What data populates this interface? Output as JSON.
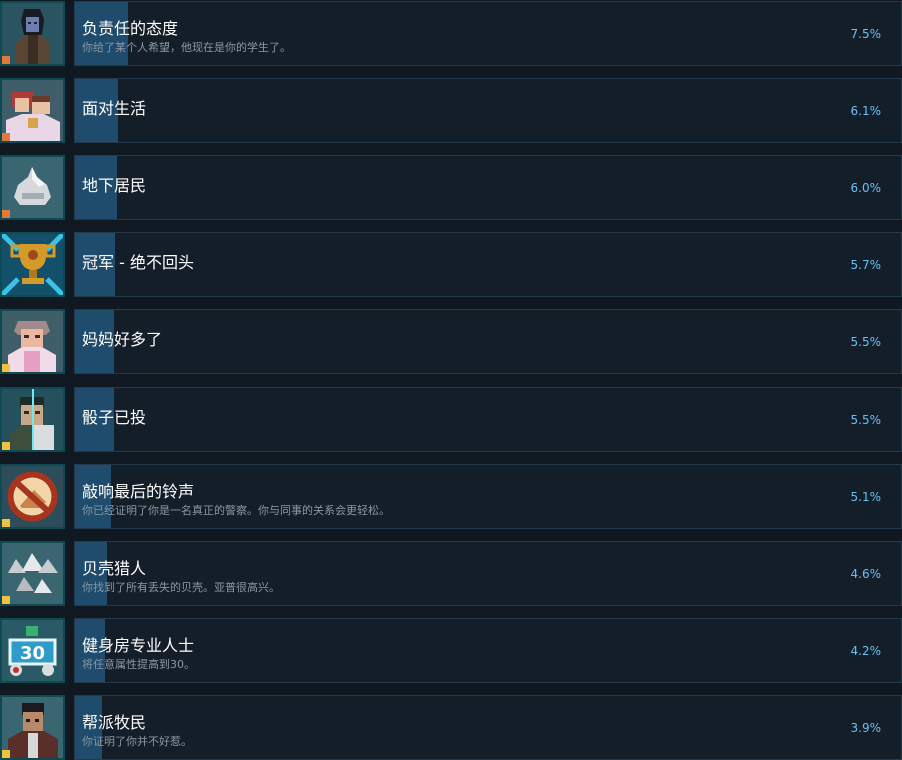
{
  "achievements": [
    {
      "icon": "dark-haired-character-icon",
      "title": "负责任的态度",
      "description": "你给了某个人希望，他现在是你的学生了。",
      "percent_label": "7.5%",
      "percent": 7.5
    },
    {
      "icon": "couple-wedding-icon",
      "title": "面对生活",
      "description": "",
      "percent_label": "6.1%",
      "percent": 6.1
    },
    {
      "icon": "white-blob-icon",
      "title": "地下居民",
      "description": "",
      "percent_label": "6.0%",
      "percent": 6.0
    },
    {
      "icon": "gold-trophy-icon",
      "title": "冠军 - 绝不回头",
      "description": "",
      "percent_label": "5.7%",
      "percent": 5.7
    },
    {
      "icon": "old-woman-icon",
      "title": "妈妈好多了",
      "description": "",
      "percent_label": "5.5%",
      "percent": 5.5
    },
    {
      "icon": "split-face-icon",
      "title": "骰子已投",
      "description": "",
      "percent_label": "5.5%",
      "percent": 5.5
    },
    {
      "icon": "no-bell-icon",
      "title": "敲响最后的铃声",
      "description": "你已经证明了你是一名真正的警察。你与同事的关系会更轻松。",
      "percent_label": "5.1%",
      "percent": 5.1
    },
    {
      "icon": "seashells-icon",
      "title": "贝壳猎人",
      "description": "你找到了所有丢失的贝壳。亚普很高兴。",
      "percent_label": "4.6%",
      "percent": 4.6
    },
    {
      "icon": "stat-30-icon",
      "title": "健身房专业人士",
      "description": "将任意属性提高到30。",
      "percent_label": "4.2%",
      "percent": 4.2
    },
    {
      "icon": "gang-member-icon",
      "title": "帮派牧民",
      "description": "你证明了你并不好惹。",
      "percent_label": "3.9%",
      "percent": 3.9
    }
  ],
  "colors": {
    "background": "#101822",
    "card": "#141e29",
    "bar": "#1f4b6c",
    "title": "#ffffff",
    "description": "#8a97a4",
    "percent": "#66c0f4"
  }
}
